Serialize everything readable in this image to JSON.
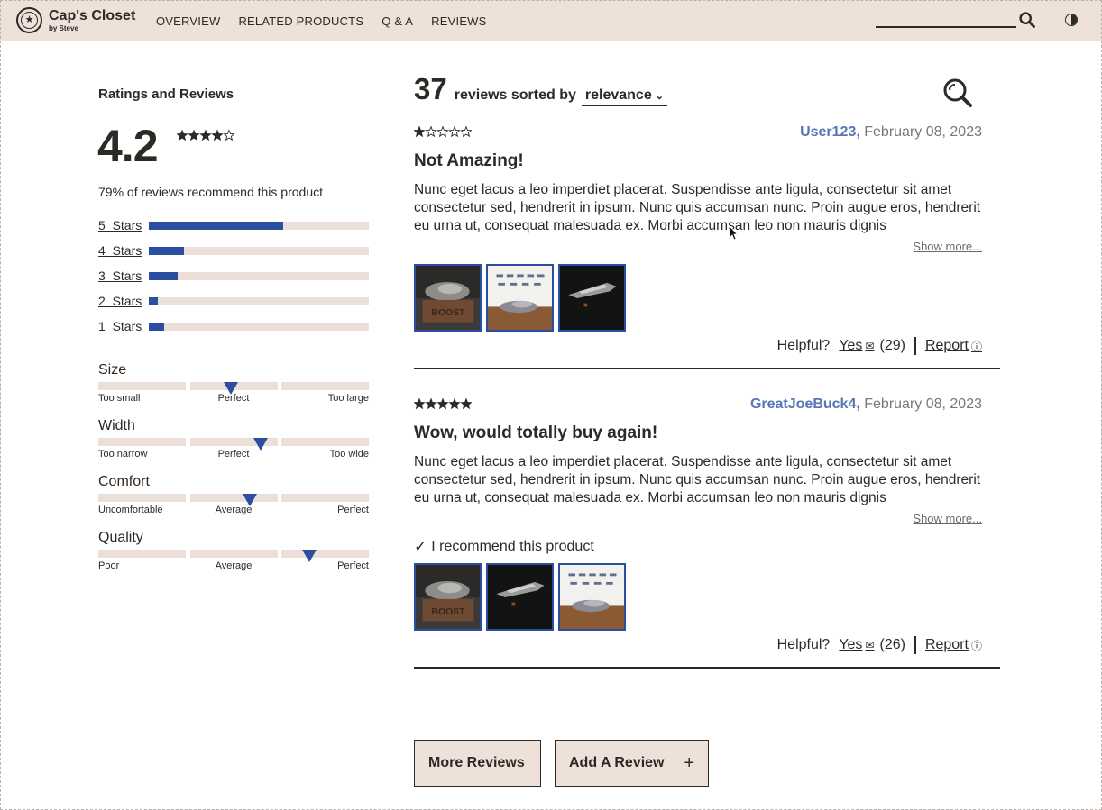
{
  "header": {
    "brand": "Cap's Closet",
    "brand_sub": "by Steve",
    "nav": [
      "OVERVIEW",
      "RELATED PRODUCTS",
      "Q & A",
      "REVIEWS"
    ],
    "search_placeholder": ""
  },
  "ratings": {
    "heading": "Ratings and Reviews",
    "average": "4.2",
    "average_stars": 4.2,
    "recommend_text": "79% of reviews recommend this product",
    "breakdown": [
      {
        "label": "5  Stars",
        "fraction": 0.61
      },
      {
        "label": "4  Stars",
        "fraction": 0.16
      },
      {
        "label": "3  Stars",
        "fraction": 0.13
      },
      {
        "label": "2  Stars",
        "fraction": 0.04
      },
      {
        "label": "1  Stars",
        "fraction": 0.07
      }
    ],
    "characteristics": [
      {
        "name": "Size",
        "low": "Too small",
        "mid": "Perfect",
        "high": "Too large",
        "value": 0.49
      },
      {
        "name": "Width",
        "low": "Too narrow",
        "mid": "Perfect",
        "high": "Too wide",
        "value": 0.6
      },
      {
        "name": "Comfort",
        "low": "Uncomfortable",
        "mid": "Average",
        "high": "Perfect",
        "value": 0.56
      },
      {
        "name": "Quality",
        "low": "Poor",
        "mid": "Average",
        "high": "Perfect",
        "value": 0.78
      }
    ]
  },
  "reviews_header": {
    "count": "37",
    "sorted_text": "reviews sorted by",
    "sort_value": "relevance"
  },
  "reviews": [
    {
      "rating": 1,
      "user": "User123,",
      "date": "February 08, 2023",
      "title": "Not Amazing!",
      "body": "Nunc eget lacus a leo imperdiet placerat. Suspendisse ante ligula, consectetur sit amet consectetur sed, hendrerit in ipsum. Nunc quis accumsan nunc. Proin augue eros, hendrerit eu urna ut, consequat malesuada ex. Morbi accumsan leo non mauris dignis",
      "show_more": "Show more...",
      "recommend": "",
      "photos": [
        "boost-box",
        "sneaker-wall",
        "dark-sneaker"
      ],
      "helpful_label": "Helpful?",
      "yes_label": "Yes",
      "yes_count": "(29)",
      "report_label": "Report"
    },
    {
      "rating": 5,
      "user": "GreatJoeBuck4,",
      "date": "February 08, 2023",
      "title": "Wow, would totally buy again!",
      "body": "Nunc eget lacus a leo imperdiet placerat. Suspendisse ante ligula, consectetur sit amet consectetur sed, hendrerit in ipsum. Nunc quis accumsan nunc. Proin augue eros, hendrerit eu urna ut, consequat malesuada ex. Morbi accumsan leo non mauris dignis",
      "show_more": "Show more...",
      "recommend": "I recommend this product",
      "photos": [
        "boost-box",
        "dark-sneaker",
        "sneaker-wall"
      ],
      "helpful_label": "Helpful?",
      "yes_label": "Yes",
      "yes_count": "(26)",
      "report_label": "Report"
    }
  ],
  "buttons": {
    "more_reviews": "More Reviews",
    "add_review": "Add A Review",
    "add_icon": "+"
  },
  "colors": {
    "accent": "#2a4fa1",
    "header_bg": "#ede1d9",
    "track": "#ecdfd8",
    "username": "#5577b5"
  }
}
